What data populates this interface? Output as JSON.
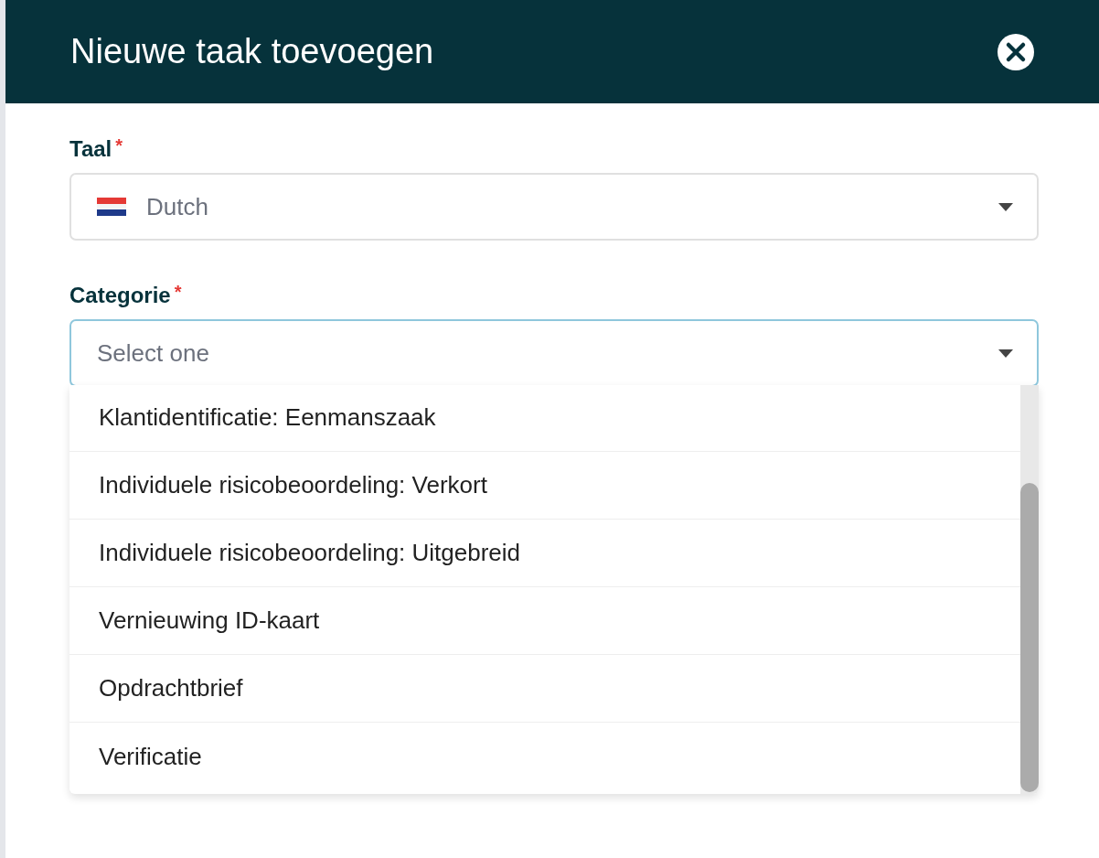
{
  "dialog": {
    "title": "Nieuwe taak toevoegen"
  },
  "fields": [
    {
      "kind": "language",
      "label": "Taal",
      "required": true,
      "required_mark": "*",
      "value": "Dutch",
      "focused": false
    },
    {
      "kind": "select",
      "label": "Categorie",
      "required": true,
      "required_mark": "*",
      "placeholder": "Select one",
      "focused": true
    }
  ],
  "dropdown": {
    "options": [
      {
        "label": "Klantidentificatie: Eenmanszaak"
      },
      {
        "label": "Individuele risicobeoordeling: Verkort"
      },
      {
        "label": "Individuele risicobeoordeling: Uitgebreid"
      },
      {
        "label": "Vernieuwing ID-kaart"
      },
      {
        "label": "Opdrachtbrief"
      },
      {
        "label": "Verificatie"
      }
    ]
  }
}
